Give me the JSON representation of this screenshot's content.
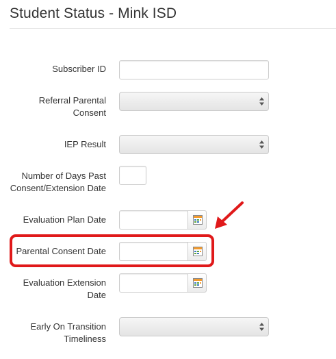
{
  "page": {
    "title": "Student Status - Mink ISD"
  },
  "form": {
    "subscriber_id": {
      "label": "Subscriber ID",
      "value": ""
    },
    "referral_parental_consent": {
      "label_line1": "Referral Parental",
      "label_line2": "Consent",
      "selected": ""
    },
    "iep_result": {
      "label": "IEP Result",
      "selected": ""
    },
    "days_past": {
      "label_line1": "Number of Days Past",
      "label_line2": "Consent/Extension Date",
      "value": ""
    },
    "evaluation_plan_date": {
      "label": "Evaluation Plan Date",
      "value": ""
    },
    "parental_consent_date": {
      "label": "Parental Consent Date",
      "value": ""
    },
    "evaluation_extension_date": {
      "label_line1": "Evaluation Extension",
      "label_line2": "Date",
      "value": ""
    },
    "early_on_transition": {
      "label_line1": "Early On Transition",
      "label_line2": "Timeliness",
      "selected": ""
    }
  },
  "icons": {
    "select_arrows": "updown-arrows-icon",
    "date_picker": "calendar-icon",
    "annotation": "red-arrow-icon"
  },
  "colors": {
    "highlight": "#e0191a",
    "calendar_orange": "#f39a2d",
    "calendar_green": "#5aa33a",
    "calendar_blue": "#3d78c2"
  }
}
